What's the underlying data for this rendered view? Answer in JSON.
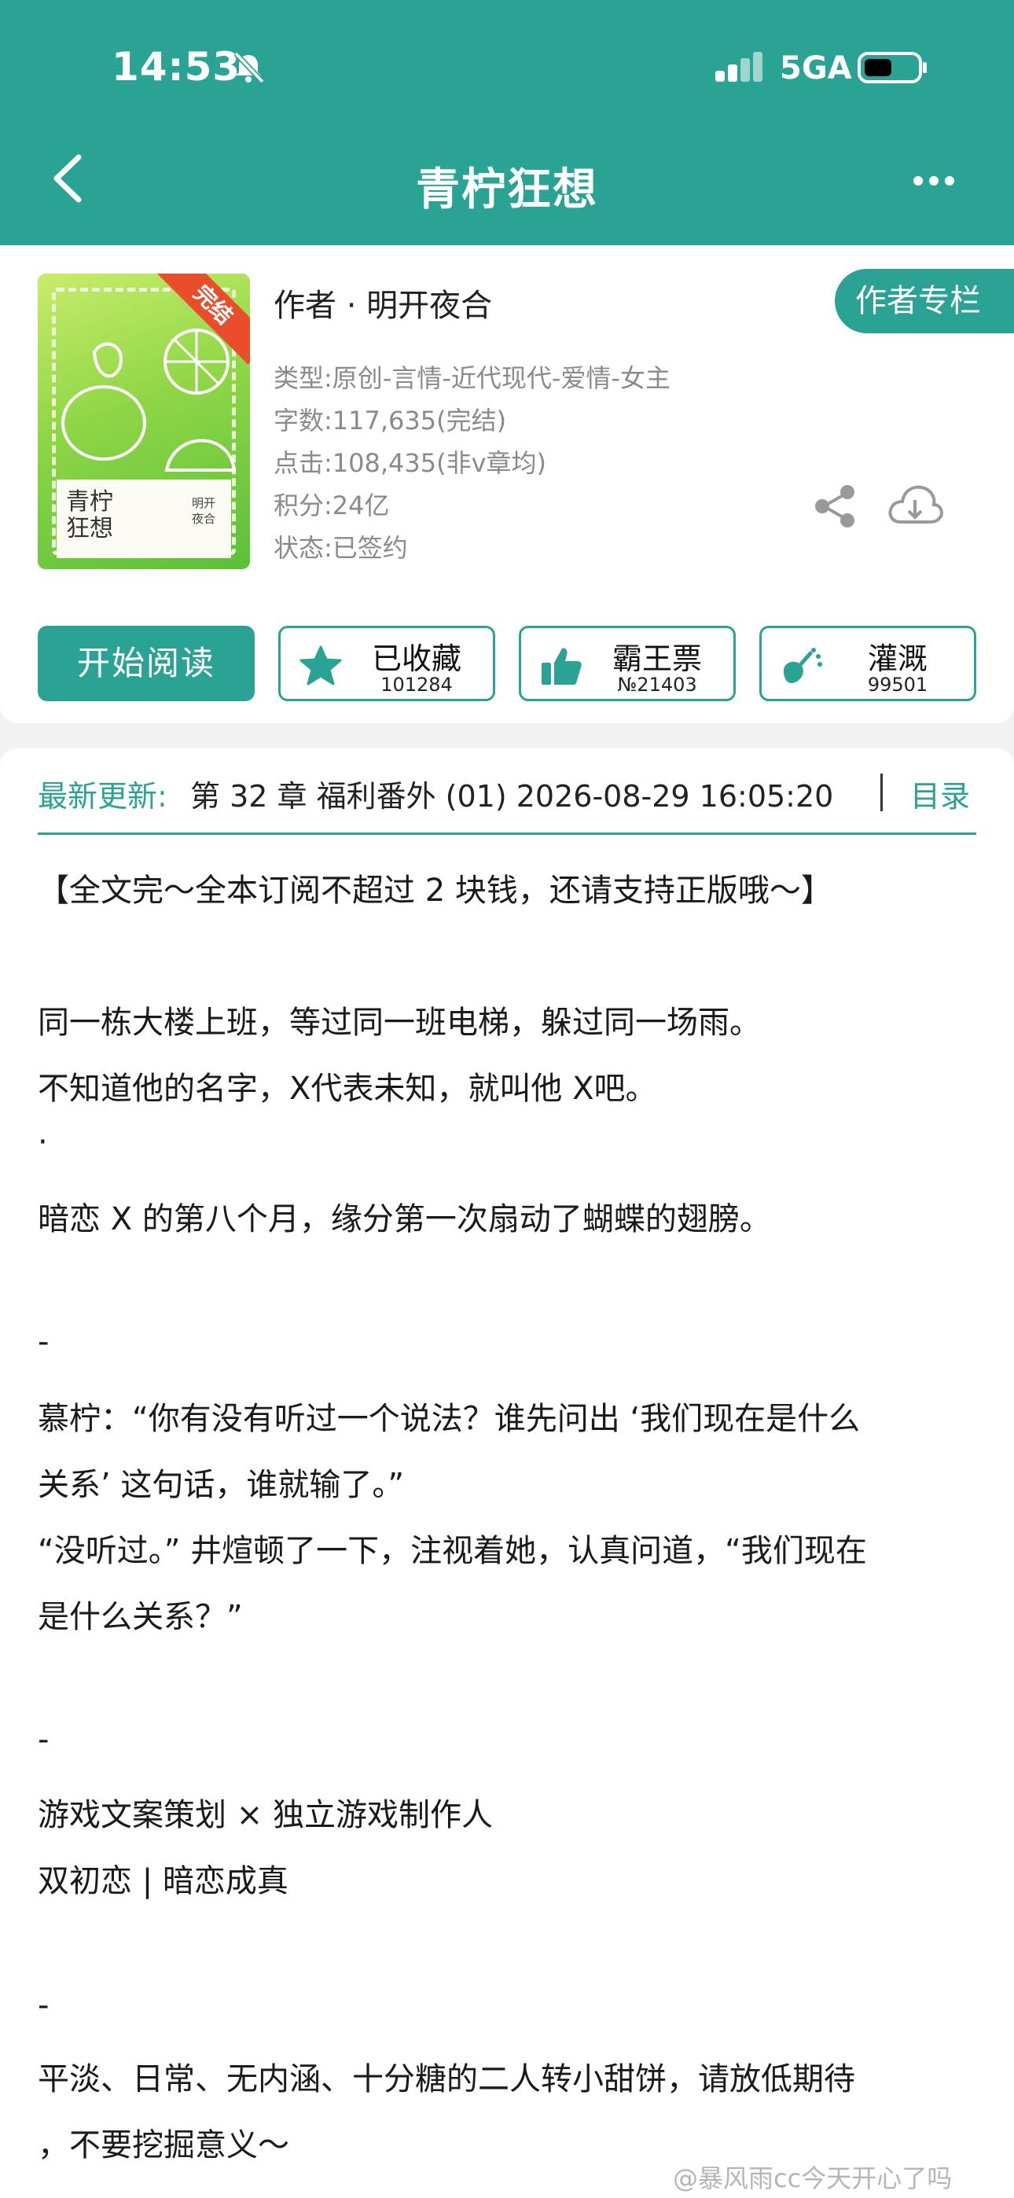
{
  "status": {
    "time": "14:53",
    "network": "5GA"
  },
  "header": {
    "title": "青柠狂想"
  },
  "book": {
    "cover_title": "青柠狂想",
    "cover_author": "明开夜合",
    "cover_badge": "完结",
    "author": "作者 · 明开夜合",
    "author_column": "作者专栏",
    "type": "类型:原创-言情-近代现代-爱情-女主",
    "words": "字数:117,635(完结)",
    "clicks": "点击:108,435(非v章均)",
    "points": "积分:24亿",
    "state": "状态:已签约"
  },
  "actions": {
    "start": "开始阅读",
    "collect": {
      "label": "已收藏",
      "count": "101284"
    },
    "ticket": {
      "label": "霸王票",
      "count": "№21403"
    },
    "water": {
      "label": "灌溉",
      "count": "99501"
    }
  },
  "update": {
    "label": "最新更新:",
    "text": "第 32 章 福利番外 (01) 2026-08-29 16:05:20",
    "toc": "目录"
  },
  "content": [
    "【全文完～全本订阅不超过 2 块钱，还请支持正版哦～】",
    "同一栋大楼上班，等过同一班电梯，躲过同一场雨。",
    "不知道他的名字，X代表未知，就叫他 X吧。",
    "·",
    "暗恋 X 的第八个月，缘分第一次扇动了蝴蝶的翅膀。",
    "-",
    "慕柠：“你有没有听过一个说法？谁先问出 ‘我们现在是什么",
    "关系’ 这句话，谁就输了。”",
    "“没听过。” 井煊顿了一下，注视着她，认真问道，“我们现在",
    "是什么关系？”",
    "-",
    "游戏文案策划 × 独立游戏制作人",
    "双初恋 | 暗恋成真",
    "-",
    "平淡、日常、无内涵、十分糖的二人转小甜饼，请放低期待",
    "，不要挖掘意义～"
  ],
  "watermark": "@暴风雨cc今天开心了吗",
  "colors": {
    "accent": "#2aa394",
    "ribbon": "#ea4d2c"
  }
}
